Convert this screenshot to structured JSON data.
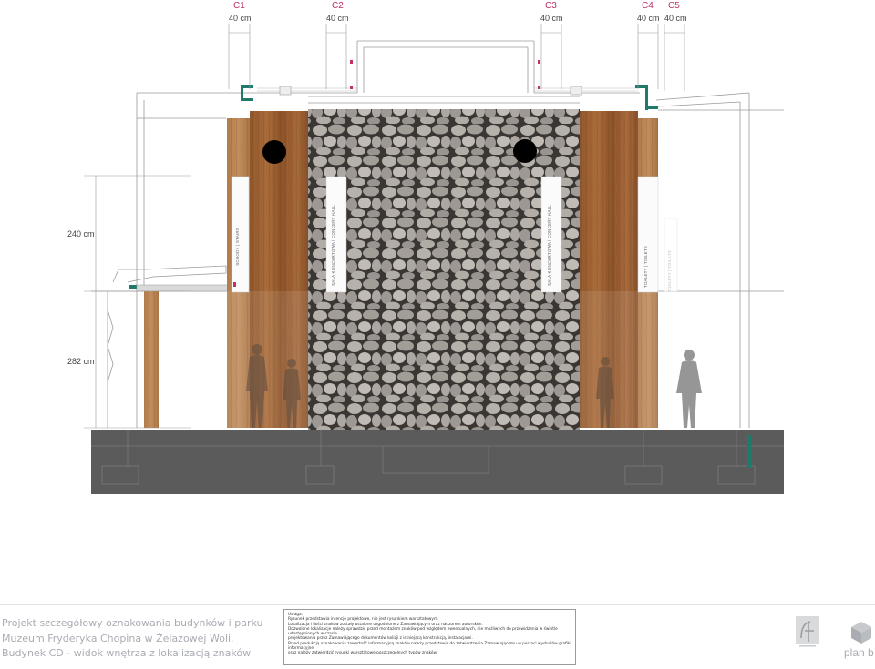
{
  "sign_columns": [
    {
      "id": "c1",
      "label": "C1",
      "width": "40 cm"
    },
    {
      "id": "c2",
      "label": "C2",
      "width": "40 cm"
    },
    {
      "id": "c3",
      "label": "C3",
      "width": "40 cm"
    },
    {
      "id": "c4",
      "label": "C4",
      "width": "40 cm"
    },
    {
      "id": "c5",
      "label": "C5",
      "width": "40 cm"
    }
  ],
  "heights": {
    "upper": "240 cm",
    "lower": "282 cm"
  },
  "signs": {
    "c1_text": "SCHODY | STAIRS",
    "c2_text": "SALA KONCERTOWA | CONCERT HALL",
    "c3_text": "SALA KONCERTOWA | CONCERT HALL",
    "c4_text": "TOALETY | TOILETS",
    "c5_text": "TOALETY | TOILETS"
  },
  "title": {
    "line1": "Projekt szczegółowy oznakowania budynków i parku",
    "line2": "Muzeum Fryderyka Chopina w Żelazowej Woli.",
    "line3": "Budynek CD - widok wnętrza z lokalizacją znaków"
  },
  "notes": {
    "heading": "Uwaga:",
    "l1": "Rysunek przedstawia intencje projektowe, nie jest rysunkiem warsztatowym.",
    "l2": "Lokalizacja i ilości znaków zostały ustalone uzgodnione z Zamawiającym oraz nadzorem autorskim.",
    "l3": "Dozwolone lokalizacje należy sprawdzić przed montażem znaków pod względem ewentualnych, nie możliwych do przewidzenia w świetle udostępnionych w czasie",
    "l4": "projektowania przez Zamawiającego dokumentów kolizji z istniejącą konstrukcją, instalacjami.",
    "l5": "Przed produkcją oznakowania zawartość informacyjną znaków należy przedstawić do zatwierdzenia Zamawiającemu w postaci wydruków grafiki informacyjnej",
    "l6": "oraz należy zatwierdzić rysunki warsztatowe poszczególnych typów znaków."
  },
  "logo_text": "plan b",
  "colors": {
    "accent_magenta": "#c0306a",
    "wood": "#9a5f30",
    "stone": "#a8a4a0",
    "floor": "#5b5b5b",
    "teal_bracket": "#1f7a6a"
  }
}
